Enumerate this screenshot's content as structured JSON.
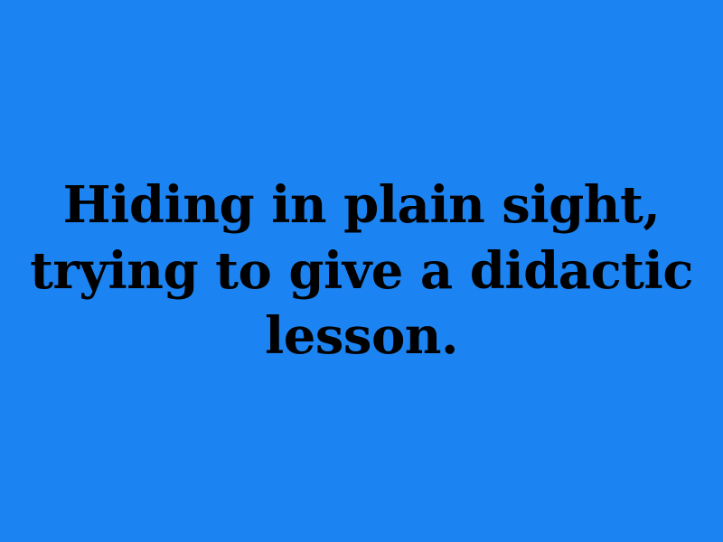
{
  "slide": {
    "text": "Hiding in plain sight, trying to give a didactic lesson.",
    "background_color": "#1C84F2",
    "text_color": "#000000"
  }
}
